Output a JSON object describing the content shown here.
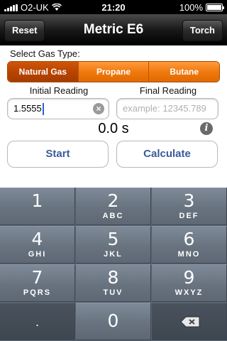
{
  "status": {
    "carrier": "O2-UK",
    "time": "21:20",
    "battery": "100%"
  },
  "nav": {
    "title": "Metric E6",
    "left_button": "Reset",
    "right_button": "Torch"
  },
  "gas": {
    "label": "Select Gas Type:",
    "options": [
      "Natural Gas",
      "Propane",
      "Butane"
    ],
    "selected": "Natural Gas"
  },
  "readings": {
    "initial_label": "Initial Reading",
    "initial_value": "1.5555",
    "final_label": "Final Reading",
    "final_placeholder": "example: 12345.789"
  },
  "timer": "0.0 s",
  "buttons": {
    "start": "Start",
    "calculate": "Calculate"
  },
  "keypad": {
    "keys": [
      {
        "num": "1",
        "letters": ""
      },
      {
        "num": "2",
        "letters": "ABC"
      },
      {
        "num": "3",
        "letters": "DEF"
      },
      {
        "num": "4",
        "letters": "GHI"
      },
      {
        "num": "5",
        "letters": "JKL"
      },
      {
        "num": "6",
        "letters": "MNO"
      },
      {
        "num": "7",
        "letters": "PQRS"
      },
      {
        "num": "8",
        "letters": "TUV"
      },
      {
        "num": "9",
        "letters": "WXYZ"
      }
    ],
    "decimal": ".",
    "zero": "0"
  },
  "icons": {
    "wifi": "wifi-icon",
    "clear": "clear-icon",
    "info": "info-icon",
    "delete": "backspace-icon"
  },
  "colors": {
    "accent": "#f07a10",
    "selected": "#b84500",
    "button_text": "#3a5a9a"
  }
}
